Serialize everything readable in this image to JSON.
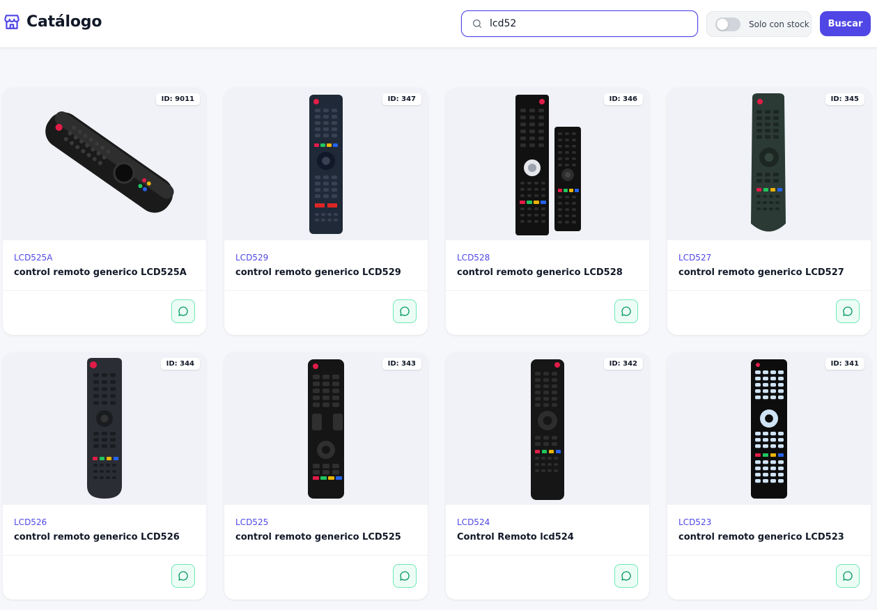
{
  "header": {
    "title": "Catálogo",
    "brand_icon": "store-icon",
    "search_value": "lcd52",
    "stock_toggle_label": "Solo con stock",
    "stock_toggle_on": false,
    "search_button": "Buscar"
  },
  "colors": {
    "accent": "#4f46e5",
    "chat_green": "#10b981",
    "page_bg": "#f6f7fa"
  },
  "products": [
    {
      "id": "ID: 9011",
      "code": "LCD525A",
      "name": "control remoto generico LCD525A",
      "image": "magic-remote"
    },
    {
      "id": "ID: 347",
      "code": "LCD529",
      "name": "control remoto generico LCD529",
      "image": "slim-remote"
    },
    {
      "id": "ID: 346",
      "code": "LCD528",
      "name": "control remoto generico LCD528",
      "image": "dual-remote"
    },
    {
      "id": "ID: 345",
      "code": "LCD527",
      "name": "control remoto generico LCD527",
      "image": "green-remote"
    },
    {
      "id": "ID: 344",
      "code": "LCD526",
      "name": "control remoto generico LCD526",
      "image": "grey-remote"
    },
    {
      "id": "ID: 343",
      "code": "LCD525",
      "name": "control remoto generico LCD525",
      "image": "lg-remote"
    },
    {
      "id": "ID: 342",
      "code": "LCD524",
      "name": "Control Remoto lcd524",
      "image": "narrow-remote"
    },
    {
      "id": "ID: 341",
      "code": "LCD523",
      "name": "control remoto generico LCD523",
      "image": "blue-key-remote"
    }
  ]
}
